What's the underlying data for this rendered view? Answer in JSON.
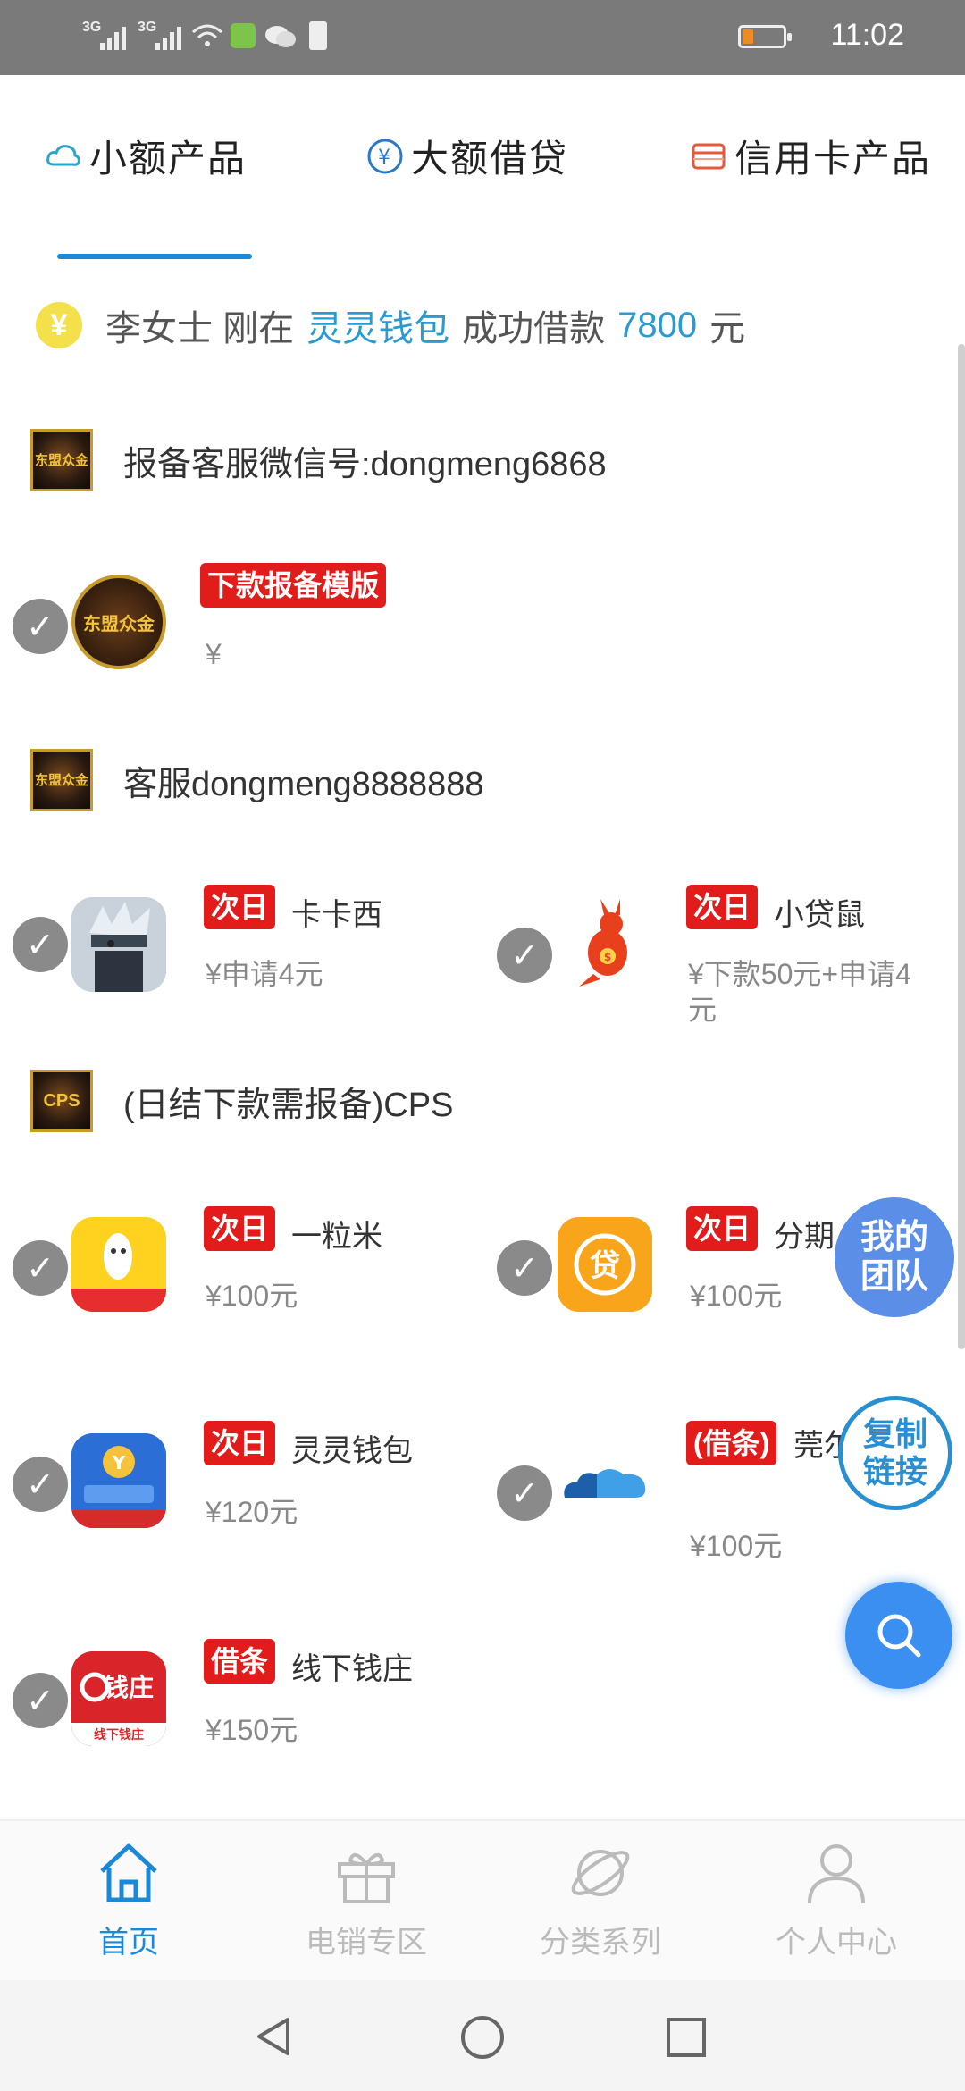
{
  "status_bar": {
    "signal_1": "3G",
    "signal_2": "3G",
    "time": "11:02"
  },
  "tabs": [
    {
      "label": "小额产品",
      "icon": "cloud-icon",
      "active": true
    },
    {
      "label": "大额借贷",
      "icon": "yen-coin-icon",
      "active": false
    },
    {
      "label": "信用卡产品",
      "icon": "credit-card-icon",
      "active": false
    }
  ],
  "notice": {
    "coin_symbol": "¥",
    "prefix": "李女士 刚在",
    "app": "灵灵钱包",
    "middle": "成功借款",
    "amount": "7800",
    "suffix": "元"
  },
  "sections": [
    {
      "title": "报备客服微信号:dongmeng6868",
      "logo_text": "东盟众金"
    },
    {
      "title": "客服dongmeng8888888",
      "logo_text": "东盟众金"
    },
    {
      "title": "(日结下款需报备)CPS",
      "logo_text": "CPS"
    }
  ],
  "products": [
    {
      "tag": "下款报备模版",
      "name": "",
      "price": "¥",
      "icon": "dongmeng-logo-icon"
    },
    {
      "tag": "次日",
      "name": "卡卡西",
      "price": "¥申请4元",
      "icon": "kakashi-avatar-icon"
    },
    {
      "tag": "次日",
      "name": "小贷鼠",
      "price": "¥下款50元+申请4元",
      "icon": "kangaroo-icon"
    },
    {
      "tag": "次日",
      "name": "一粒米",
      "price": "¥100元",
      "icon": "rice-grain-icon"
    },
    {
      "tag": "次日",
      "name": "分期",
      "price": "¥100元",
      "icon": "loan-coin-icon"
    },
    {
      "tag": "次日",
      "name": "灵灵钱包",
      "price": "¥120元",
      "icon": "lingling-wallet-icon"
    },
    {
      "tag": "(借条)",
      "name": "莞尔借条",
      "price": "¥100元",
      "icon": "cloud-blue-icon"
    },
    {
      "tag": "借条",
      "name": "线下钱庄",
      "price": "¥150元",
      "icon": "qianzhuang-icon"
    }
  ],
  "floating": {
    "my_team": "我的团队",
    "copy_link": "复制链接"
  },
  "bottom_nav": [
    {
      "label": "首页",
      "icon": "home-icon",
      "active": true
    },
    {
      "label": "电销专区",
      "icon": "gift-icon",
      "active": false
    },
    {
      "label": "分类系列",
      "icon": "planet-icon",
      "active": false
    },
    {
      "label": "个人中心",
      "icon": "person-icon",
      "active": false
    }
  ],
  "colors": {
    "accent": "#1a8ad8",
    "tag_red": "#e21b1b",
    "highlight": "#2a9bd1"
  }
}
